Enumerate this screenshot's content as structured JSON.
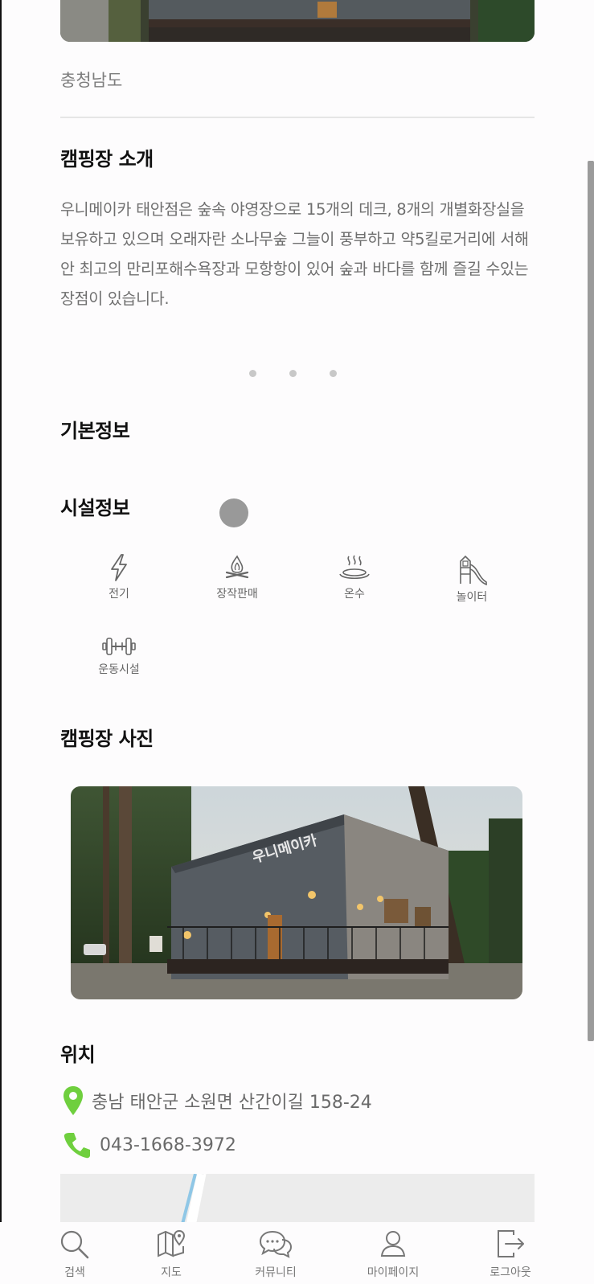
{
  "region": "충청남도",
  "intro": {
    "title": "캠핑장 소개",
    "text": "우니메이카 태안점은 숲속 야영장으로 15개의 데크, 8개의 개별화장실을 보유하고 있으며 오래자란 소나무숲 그늘이 풍부하고 약5킬로거리에 서해안 최고의 만리포해수욕장과 모항항이 있어 숲과 바다를 함께 즐길 수있는 장점이 있습니다."
  },
  "basic_info": {
    "title": "기본정보"
  },
  "facilities": {
    "title": "시설정보",
    "items": [
      {
        "label": "전기",
        "icon": "lightning-icon"
      },
      {
        "label": "장작판매",
        "icon": "campfire-icon"
      },
      {
        "label": "온수",
        "icon": "hot-water-icon"
      },
      {
        "label": "놀이터",
        "icon": "playground-slide-icon"
      },
      {
        "label": "운동시설",
        "icon": "dumbbell-icon"
      }
    ]
  },
  "photos": {
    "title": "캠핑장 사진",
    "sign_text": "우니메이카"
  },
  "location": {
    "title": "위치",
    "address": "충남 태안군 소원면 산간이길 158-24",
    "phone": "043-1668-3972",
    "colors": {
      "pin": "#6fcf3e",
      "phone": "#6fcf3e"
    }
  },
  "tabbar": {
    "items": [
      {
        "label": "검색",
        "icon": "search-icon"
      },
      {
        "label": "지도",
        "icon": "map-icon"
      },
      {
        "label": "커뮤니티",
        "icon": "chat-icon"
      },
      {
        "label": "마이페이지",
        "icon": "user-icon"
      },
      {
        "label": "로그아웃",
        "icon": "logout-icon"
      }
    ]
  }
}
